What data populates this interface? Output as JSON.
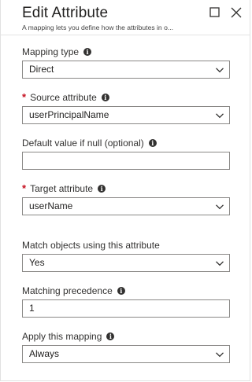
{
  "header": {
    "title": "Edit Attribute",
    "subtitle": "A mapping lets you define how the attributes in o...",
    "maximize_icon": "maximize-icon",
    "close_icon": "close-icon"
  },
  "fields": {
    "mapping_type": {
      "label": "Mapping type",
      "required": false,
      "value": "Direct"
    },
    "source_attribute": {
      "label": "Source attribute",
      "required": true,
      "required_mark": "*",
      "value": "userPrincipalName"
    },
    "default_value": {
      "label": "Default value if null (optional)",
      "required": false,
      "value": ""
    },
    "target_attribute": {
      "label": "Target attribute",
      "required": true,
      "required_mark": "*",
      "value": "userName"
    },
    "match_objects": {
      "label": "Match objects using this attribute",
      "value": "Yes"
    },
    "matching_precedence": {
      "label": "Matching precedence",
      "value": "1"
    },
    "apply_mapping": {
      "label": "Apply this mapping",
      "value": "Always"
    }
  },
  "info_glyph": "i",
  "colors": {
    "required": "#c50f1f",
    "border": "#8a8886",
    "text": "#323130"
  }
}
